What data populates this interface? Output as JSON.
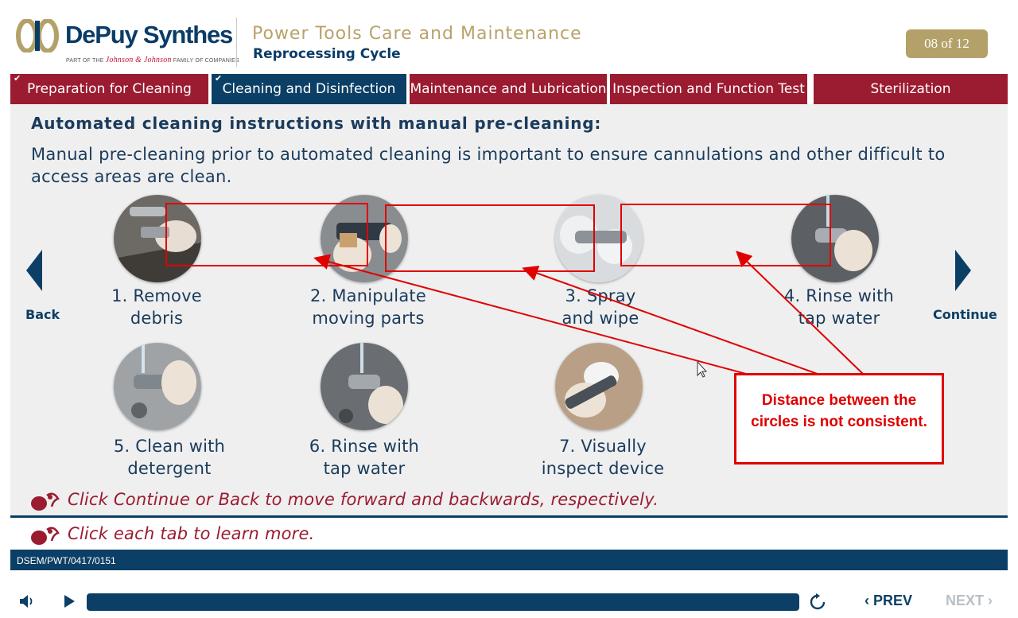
{
  "header": {
    "brand": "DePuy Synthes",
    "brand_tagline_prefix": "PART OF THE",
    "brand_tagline_jj": "Johnson & Johnson",
    "brand_tagline_suffix": "FAMILY OF COMPANIES",
    "course_title": "Power Tools Care and Maintenance",
    "course_subtitle": "Reprocessing Cycle",
    "page_indicator": "08 of 12"
  },
  "tabs": [
    {
      "label": "Preparation for Cleaning",
      "visited": true,
      "active": false
    },
    {
      "label": "Cleaning and Disinfection",
      "visited": true,
      "active": true
    },
    {
      "label": "Maintenance and Lubrication",
      "visited": false,
      "active": false
    },
    {
      "label": "Inspection and Function Test",
      "visited": false,
      "active": false
    },
    {
      "label": "Sterilization",
      "visited": false,
      "active": false
    }
  ],
  "content": {
    "heading": "Automated cleaning instructions with manual pre-cleaning:",
    "body": "Manual pre-cleaning prior to automated cleaning is important to ensure cannulations and other difficult to access areas are clean.",
    "steps": [
      {
        "line1": "1. Remove",
        "line2": "debris"
      },
      {
        "line1": "2. Manipulate",
        "line2": "moving parts"
      },
      {
        "line1": "3. Spray",
        "line2": "and wipe"
      },
      {
        "line1": "4. Rinse with",
        "line2": "tap water"
      },
      {
        "line1": "5. Clean with",
        "line2": "detergent"
      },
      {
        "line1": "6. Rinse with",
        "line2": "tap water"
      },
      {
        "line1": "7. Visually",
        "line2": "inspect device"
      }
    ]
  },
  "navigation": {
    "back_label": "Back",
    "continue_label": "Continue"
  },
  "hints": {
    "continue_back": "Click Continue or Back to move forward and backwards, respectively.",
    "tabs": "Click each tab to learn more."
  },
  "annotation": {
    "note": "Distance between the circles is not consistent.",
    "color": "#e00000"
  },
  "footer": {
    "doc_code": "DSEM/PWT/0417/0151",
    "prev_label": "PREV",
    "next_label": "NEXT",
    "progress_fraction": 1.0
  },
  "colors": {
    "navy": "#0c3f66",
    "maroon": "#9b1b30",
    "gold": "#b3a169"
  }
}
